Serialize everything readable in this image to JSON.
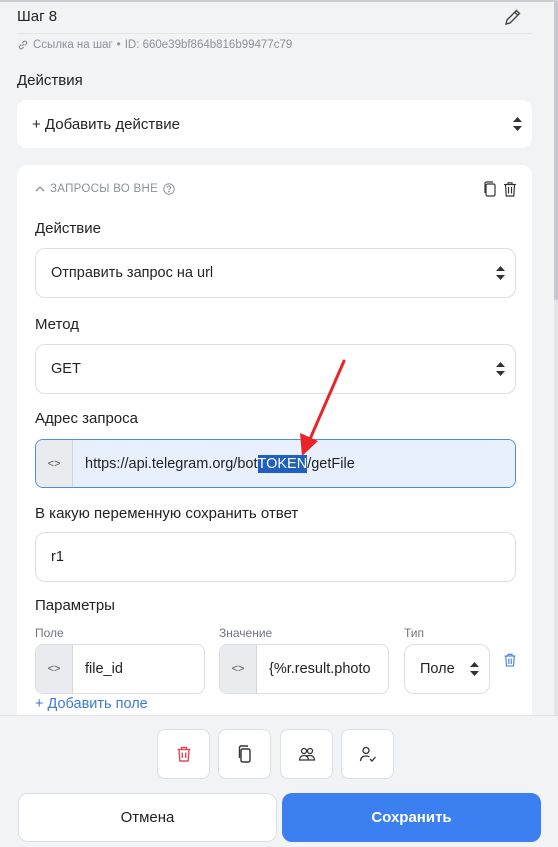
{
  "step": {
    "title": "Шаг 8",
    "link_label": "Ссылка на шаг",
    "separator": "•",
    "id_text": "ID: 660e39bf864b816b99477c79"
  },
  "actions": {
    "label": "Действия",
    "add_action": "+ Добавить действие"
  },
  "card": {
    "header": "ЗАПРОСЫ ВО ВНЕ",
    "action_label": "Действие",
    "action_value": "Отправить запрос на url",
    "method_label": "Метод",
    "method_value": "GET",
    "url_label": "Адрес запроса",
    "url_code": "<>",
    "url_prefix": "https://api.telegram.org/bot",
    "url_selected": "TOKEN",
    "url_suffix": "/getFile",
    "save_var_label": "В какую переменную сохранить ответ",
    "save_var_value": "r1",
    "params_label": "Параметры",
    "param_field_label": "Поле",
    "param_value_label": "Значение",
    "param_type_label": "Тип",
    "param_field_value": "file_id",
    "param_value_value": "{%r.result.photo",
    "param_type_value": "Поле",
    "add_field": "+ Добавить поле"
  },
  "footer": {
    "cancel": "Отмена",
    "save": "Сохранить"
  },
  "colors": {
    "accent": "#3b7ff0",
    "danger": "#e04a5a",
    "selection": "#1f5fbf",
    "arrow": "#e8262a"
  }
}
